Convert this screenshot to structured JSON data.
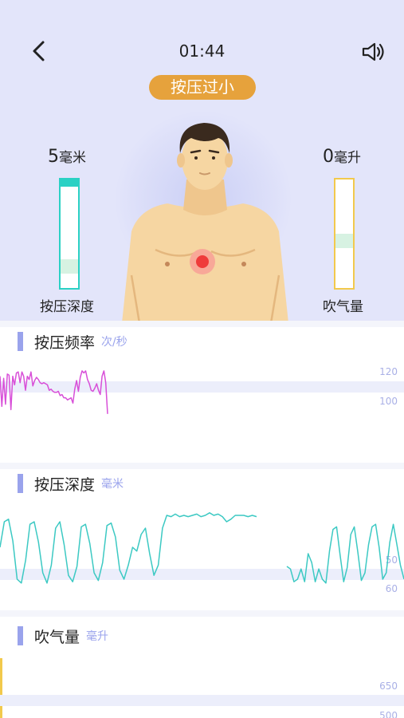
{
  "header": {
    "timer": "01:44"
  },
  "status_badge": "按压过小",
  "depth_gauge": {
    "value": "5",
    "unit": "毫米",
    "label": "按压深度",
    "color": "#2bd1c4"
  },
  "breath_gauge": {
    "value": "0",
    "unit": "毫升",
    "label": "吹气量",
    "color": "#f2c94c"
  },
  "charts": {
    "rate": {
      "title": "按压频率",
      "unit": "次/秒",
      "ticks": [
        "120",
        "100"
      ],
      "color": "#d84fd8"
    },
    "depth": {
      "title": "按压深度",
      "unit": "毫米",
      "ticks": [
        "50",
        "60"
      ],
      "color": "#3cc9c3"
    },
    "breath": {
      "title": "吹气量",
      "unit": "毫升",
      "ticks": [
        "650",
        "500"
      ],
      "color": "#f2c94c"
    }
  },
  "chart_data": [
    {
      "type": "line",
      "title": "按压频率",
      "ylabel": "次/秒",
      "x": [
        0,
        1,
        2,
        3,
        4,
        5,
        6,
        7,
        8,
        9,
        10,
        11,
        12,
        13,
        14,
        15,
        16,
        17,
        18,
        19,
        20,
        21,
        22,
        23,
        24,
        25,
        26,
        27,
        28,
        29,
        30,
        31,
        32,
        33,
        34,
        35,
        36,
        37,
        38,
        39,
        40,
        41,
        42,
        43,
        44,
        45,
        46,
        47,
        48,
        49,
        50,
        51,
        52,
        53,
        54,
        55,
        56,
        57,
        58,
        59
      ],
      "series": [
        {
          "values": [
            124,
            96,
            122,
            98,
            126,
            125,
            93,
            124,
            116,
            127,
            128,
            118,
            128,
            124,
            111,
            124,
            121,
            128,
            115,
            120,
            123,
            121,
            118,
            117,
            118,
            117,
            116,
            111,
            112,
            110,
            109,
            109,
            110,
            106,
            107,
            104,
            104,
            102,
            103,
            104,
            99,
            112,
            120,
            110,
            123,
            129,
            127,
            129,
            121,
            117,
            111,
            110,
            113,
            117,
            111,
            107,
            124,
            129,
            118,
            89
          ]
        }
      ]
    },
    {
      "type": "line",
      "title": "按压深度",
      "ylabel": "毫米",
      "series": [
        {
          "name": "",
          "values": [
            30,
            10,
            8,
            25,
            55,
            58,
            40,
            12,
            10,
            26,
            50,
            58,
            44,
            15,
            10,
            28,
            52,
            57,
            45,
            14,
            12,
            27,
            50,
            56,
            42,
            13,
            11,
            22,
            48,
            55,
            44,
            30,
            33,
            20,
            15,
            35,
            52,
            44,
            15,
            5,
            6,
            4,
            6,
            5,
            6,
            5,
            4,
            6,
            5,
            3,
            5,
            4,
            6,
            10,
            8,
            5,
            5,
            5,
            6,
            5,
            6
          ]
        },
        {
          "name": "",
          "values": [
            45,
            47,
            57,
            55,
            47,
            57,
            35,
            42,
            57,
            47,
            55,
            58,
            33,
            16,
            14,
            36,
            57,
            46,
            20,
            14,
            34,
            56,
            50,
            28,
            14,
            12,
            30,
            55,
            50,
            26,
            12,
            28,
            44,
            55
          ]
        }
      ]
    },
    {
      "type": "line",
      "title": "吹气量",
      "ylabel": "毫升",
      "series": [
        {
          "values": []
        }
      ]
    }
  ]
}
